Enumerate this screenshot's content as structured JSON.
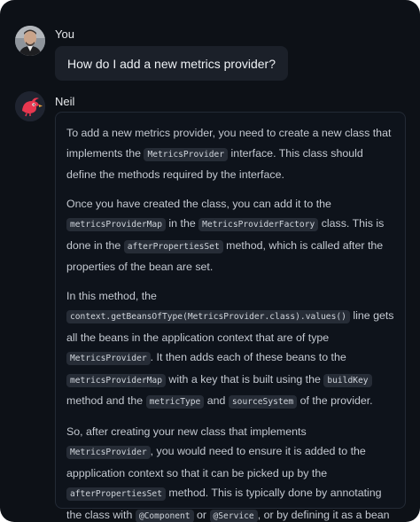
{
  "conversation": {
    "user": {
      "name": "You",
      "message": "How do I add a new metrics provider?"
    },
    "assistant": {
      "name": "Neil",
      "paragraphs": [
        [
          {
            "t": "To add a new metrics provider, you need to create a new class that implements the "
          },
          {
            "c": "MetricsProvider"
          },
          {
            "t": " interface. This class should define the methods required by the interface."
          }
        ],
        [
          {
            "t": "Once you have created the class, you can add it to the "
          },
          {
            "c": "metricsProviderMap"
          },
          {
            "t": " in the "
          },
          {
            "c": "MetricsProviderFactory"
          },
          {
            "t": " class. This is done in the "
          },
          {
            "c": "afterPropertiesSet"
          },
          {
            "t": " method, which is called after the properties of the bean are set."
          }
        ],
        [
          {
            "t": "In this method, the "
          },
          {
            "c": "context.getBeansOfType(MetricsProvider.class).values()"
          },
          {
            "t": " line gets all the beans in the application context that are of type "
          },
          {
            "c": "MetricsProvider"
          },
          {
            "t": ". It then adds each of these beans to the "
          },
          {
            "c": "metricsProviderMap"
          },
          {
            "t": " with a key that is built using the "
          },
          {
            "c": "buildKey"
          },
          {
            "t": " method and the "
          },
          {
            "c": "metricType"
          },
          {
            "t": " and "
          },
          {
            "c": "sourceSystem"
          },
          {
            "t": " of the provider."
          }
        ],
        [
          {
            "t": "So, after creating your new class that implements "
          },
          {
            "c": "MetricsProvider"
          },
          {
            "t": ", you would need to ensure it is added to the appplication context so that it can be picked up by the "
          },
          {
            "c": "afterPropertiesSet"
          },
          {
            "t": " method. This is typically done by annotating the class with "
          },
          {
            "c": "@Component"
          },
          {
            "t": " or "
          },
          {
            "c": "@Service"
          },
          {
            "t": ", or by defining it as a bean in a configuration class."
          }
        ]
      ]
    }
  },
  "icons": {
    "user_avatar": "user-photo-avatar",
    "assistant_avatar": "red-bird-avatar"
  },
  "colors": {
    "background": "#0d1117",
    "bubble": "#1b2029",
    "card_border": "#232a35",
    "code_background": "#262c36",
    "assistant_avatar_accent": "#e8374f"
  }
}
